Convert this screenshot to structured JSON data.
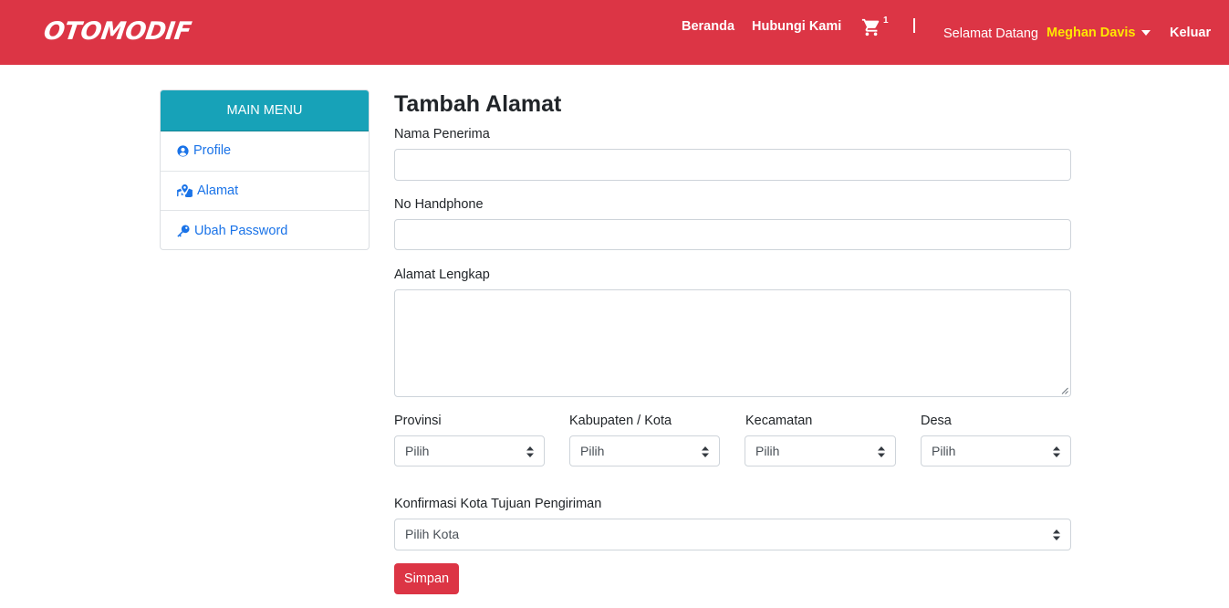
{
  "navbar": {
    "brand": "OTOMODIF",
    "links": {
      "home": "Beranda",
      "contact": "Hubungi Kami"
    },
    "cart_count": "1",
    "welcome_text": "Selamat Datang",
    "username": "Meghan Davis",
    "logout": "Keluar",
    "bg_color": "#dc3545",
    "username_color": "#ffe600"
  },
  "sidebar": {
    "header": "MAIN MENU",
    "header_color": "#17a2b8",
    "items": [
      {
        "label": "Profile",
        "icon": "user-circle-icon"
      },
      {
        "label": "Alamat",
        "icon": "map-marked-icon"
      },
      {
        "label": "Ubah Password",
        "icon": "key-icon"
      }
    ]
  },
  "form": {
    "title": "Tambah Alamat",
    "nama_label": "Nama Penerima",
    "nama_value": "",
    "phone_label": "No Handphone",
    "phone_value": "",
    "alamat_label": "Alamat Lengkap",
    "alamat_value": "",
    "provinsi_label": "Provinsi",
    "provinsi_value": "Pilih",
    "kota_label": "Kabupaten / Kota",
    "kota_value": "Pilih",
    "kecamatan_label": "Kecamatan",
    "kecamatan_value": "Pilih",
    "desa_label": "Desa",
    "desa_value": "Pilih",
    "konfirmasi_label": "Konfirmasi Kota Tujuan Pengiriman",
    "konfirmasi_value": "Pilih Kota",
    "submit": "Simpan"
  }
}
